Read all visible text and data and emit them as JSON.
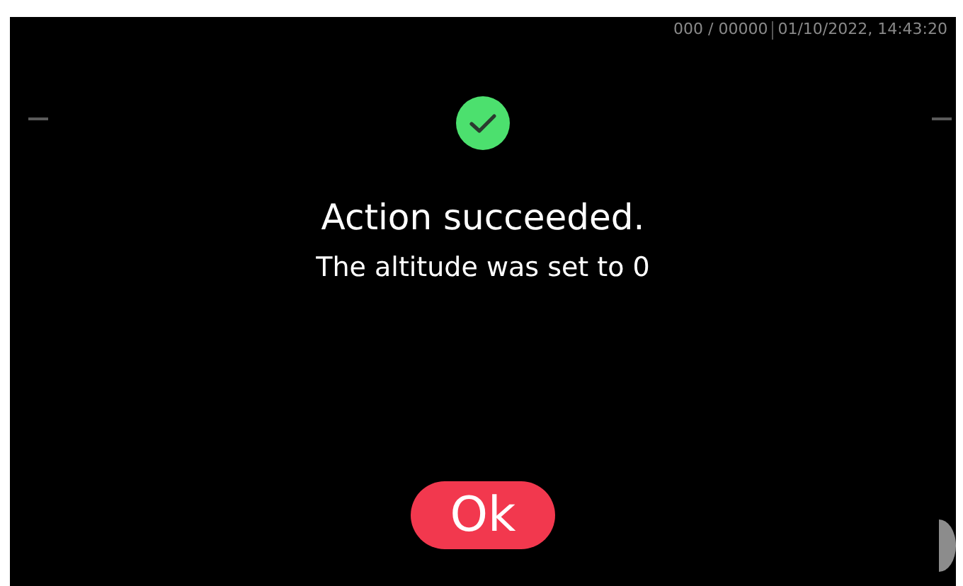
{
  "status_bar": {
    "counter": "000 / 00000",
    "datetime": "01/10/2022, 14:43:20"
  },
  "dialog": {
    "kind": "success",
    "title": "Action succeeded.",
    "message": "The altitude was set to 0"
  },
  "buttons": [
    {
      "label": "Ok"
    }
  ]
}
